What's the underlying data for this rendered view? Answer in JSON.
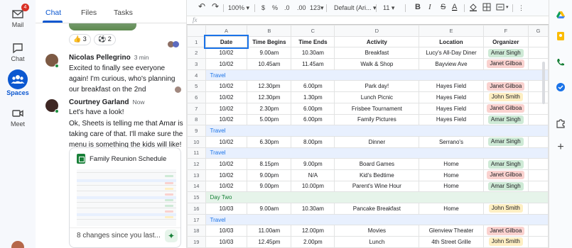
{
  "rail": {
    "mail": {
      "label": "Mail",
      "badge": "4"
    },
    "chat": {
      "label": "Chat"
    },
    "spaces": {
      "label": "Spaces"
    },
    "meet": {
      "label": "Meet"
    }
  },
  "chat_panel": {
    "tabs": [
      "Chat",
      "Files",
      "Tasks"
    ],
    "reactions": [
      {
        "emoji": "👍",
        "count": "3"
      },
      {
        "emoji": "⚽",
        "count": "2"
      }
    ],
    "messages": [
      {
        "sender": "Nicolas Pellegrino",
        "time": "3 min",
        "text": "Excited to finally see everyone again! I'm curious, who's planning our breakfast on the 2nd"
      },
      {
        "sender": "Courtney Garland",
        "time": "Now",
        "text": "Let's have a look!"
      },
      {
        "sender": "",
        "time": "",
        "text": "Ok, Sheets is telling me that Amar is taking care of that. I'll make sure the menu is something the kids will like!"
      }
    ],
    "card": {
      "title": "Family Reunion Schedule",
      "footer": "8 changes since you last..."
    }
  },
  "toolbar": {
    "zoom": "100%",
    "currency": "$",
    "percent": "%",
    "dec_less": ".0",
    "dec_more": ".00",
    "format": "123",
    "font": "Default (Ari...",
    "size": "11",
    "bold": "B",
    "italic": "I",
    "strike": "S",
    "text_color": "A"
  },
  "formula_bar": {
    "fx": "fx"
  },
  "colors": {
    "travel_bg": "#e8f0fe",
    "travel_text": "#1a73e8",
    "day_bg": "#e6f4ea",
    "day_text": "#188038",
    "amar": "#ceead6",
    "janet": "#fad2cf",
    "john": "#feefc3"
  },
  "sheet": {
    "columns": [
      "A",
      "B",
      "C",
      "D",
      "E",
      "F",
      "G"
    ],
    "rows": [
      {
        "n": "1",
        "type": "header",
        "cells": [
          "Date",
          "Time Begins",
          "Time Ends",
          "Activity",
          "Location",
          "Organizer"
        ]
      },
      {
        "n": "2",
        "type": "data",
        "cells": [
          "10/02",
          "9.00am",
          "10.30am",
          "Breakfast",
          "Lucy's All-Day Diner",
          "Amar Singh"
        ],
        "tag": "amar"
      },
      {
        "n": "3",
        "type": "data",
        "cells": [
          "10/02",
          "10.45am",
          "11.45am",
          "Walk & Shop",
          "Bayview Ave",
          "Janet Gilboa"
        ],
        "tag": "janet"
      },
      {
        "n": "4",
        "type": "travel",
        "label": "Travel"
      },
      {
        "n": "5",
        "type": "data",
        "cells": [
          "10/02",
          "12.30pm",
          "6.00pm",
          "Park day!",
          "Hayes Field",
          "Janet Gilboa"
        ],
        "tag": "janet"
      },
      {
        "n": "6",
        "type": "data",
        "cells": [
          "10/02",
          "12.30pm",
          "1.30pm",
          "Lunch Picnic",
          "Hayes Field",
          "John Smith"
        ],
        "tag": "john"
      },
      {
        "n": "7",
        "type": "data",
        "cells": [
          "10/02",
          "2.30pm",
          "6.00pm",
          "Frisbee Tournament",
          "Hayes Field",
          "Janet Gilboa"
        ],
        "tag": "janet"
      },
      {
        "n": "8",
        "type": "data",
        "cells": [
          "10/02",
          "5.00pm",
          "6.00pm",
          "Family Pictures",
          "Hayes Field",
          "Amar Singh"
        ],
        "tag": "amar"
      },
      {
        "n": "9",
        "type": "travel",
        "label": "Travel"
      },
      {
        "n": "10",
        "type": "data",
        "cells": [
          "10/02",
          "6.30pm",
          "8.00pm",
          "Dinner",
          "Serrano's",
          "Amar Singh"
        ],
        "tag": "amar"
      },
      {
        "n": "11",
        "type": "travel",
        "label": "Travel"
      },
      {
        "n": "12",
        "type": "data",
        "cells": [
          "10/02",
          "8.15pm",
          "9.00pm",
          "Board Games",
          "Home",
          "Amar Singh"
        ],
        "tag": "amar"
      },
      {
        "n": "13",
        "type": "data",
        "cells": [
          "10/02",
          "9.00pm",
          "N/A",
          "Kid's Bedtime",
          "Home",
          "Janet Gilboa"
        ],
        "tag": "janet"
      },
      {
        "n": "14",
        "type": "data",
        "cells": [
          "10/02",
          "9.00pm",
          "10.00pm",
          "Parent's Wine Hour",
          "Home",
          "Amar Singh"
        ],
        "tag": "amar"
      },
      {
        "n": "15",
        "type": "day",
        "label": "Day Two"
      },
      {
        "n": "16",
        "type": "data",
        "cells": [
          "10/03",
          "9.00am",
          "10.30am",
          "Pancake Breakfast",
          "Home",
          "John Smith"
        ],
        "tag": "john"
      },
      {
        "n": "17",
        "type": "travel",
        "label": "Travel"
      },
      {
        "n": "18",
        "type": "data",
        "cells": [
          "10/03",
          "11.00am",
          "12.00pm",
          "Movies",
          "Glenview Theater",
          "Janet Gilboa"
        ],
        "tag": "janet"
      },
      {
        "n": "19",
        "type": "data",
        "cells": [
          "10/03",
          "12.45pm",
          "2.00pm",
          "Lunch",
          "4th Street Grille",
          "John Smith"
        ],
        "tag": "john"
      }
    ]
  }
}
